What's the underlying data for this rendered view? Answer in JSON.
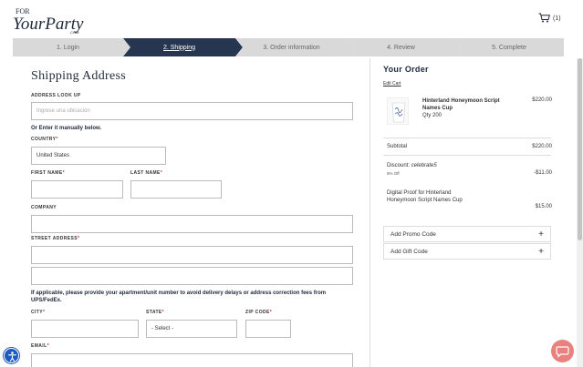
{
  "header": {
    "logo_text": "FOR Your Party .COM",
    "cart_count": "(1)"
  },
  "steps": [
    {
      "label": "1. Login",
      "active": false
    },
    {
      "label": "2. Shipping",
      "active": true
    },
    {
      "label": "3. Order information",
      "active": false
    },
    {
      "label": "4. Review",
      "active": false
    },
    {
      "label": "5. Complete",
      "active": false
    }
  ],
  "shipping": {
    "title": "Shipping Address",
    "address_lookup_label": "ADDRESS LOOK UP",
    "address_lookup_placeholder": "Ingrese una ubicación",
    "manual_note": "Or Enter it manually below.",
    "country_label": "COUNTRY",
    "country_value": "United States",
    "first_name_label": "FIRST NAME",
    "last_name_label": "LAST NAME",
    "company_label": "COMPANY",
    "street_label": "STREET ADDRESS",
    "apartment_note": "If applicable, please provide your apartment/unit number to avoid delivery delays or address correction fees from UPS/FedEx.",
    "city_label": "CITY",
    "state_label": "STATE",
    "state_value": "- Select -",
    "zip_label": "ZIP CODE",
    "email_label": "EMAIL",
    "required_mark": "*"
  },
  "order": {
    "title": "Your Order",
    "edit_cart": "Edit Cart",
    "item_name": "Hinterland Honeymoon Script Names Cup",
    "item_qty": "Qty 200",
    "item_price": "$220.00",
    "subtotal_label": "Subtotal",
    "subtotal_value": "$220.00",
    "discount_label": "Discount:",
    "discount_code": "celebrate5",
    "discount_pct": "5% Off",
    "discount_value": "-$11.00",
    "proof_label": "Digital Proof for Hinterland Honeymoon Script Names Cup",
    "proof_value": "$15.00",
    "promo_label": "Add Promo Code",
    "gift_label": "Add Gift Code",
    "plus": "+"
  },
  "colors": {
    "active_step": "#263650",
    "inactive_step": "#d9d9d9",
    "navy": "#1e2a3b",
    "chat": "#e9817e",
    "a11y": "#1d5bbf"
  },
  "icons": [
    "cart-icon",
    "plus-icon",
    "accessibility-icon",
    "chat-icon"
  ]
}
